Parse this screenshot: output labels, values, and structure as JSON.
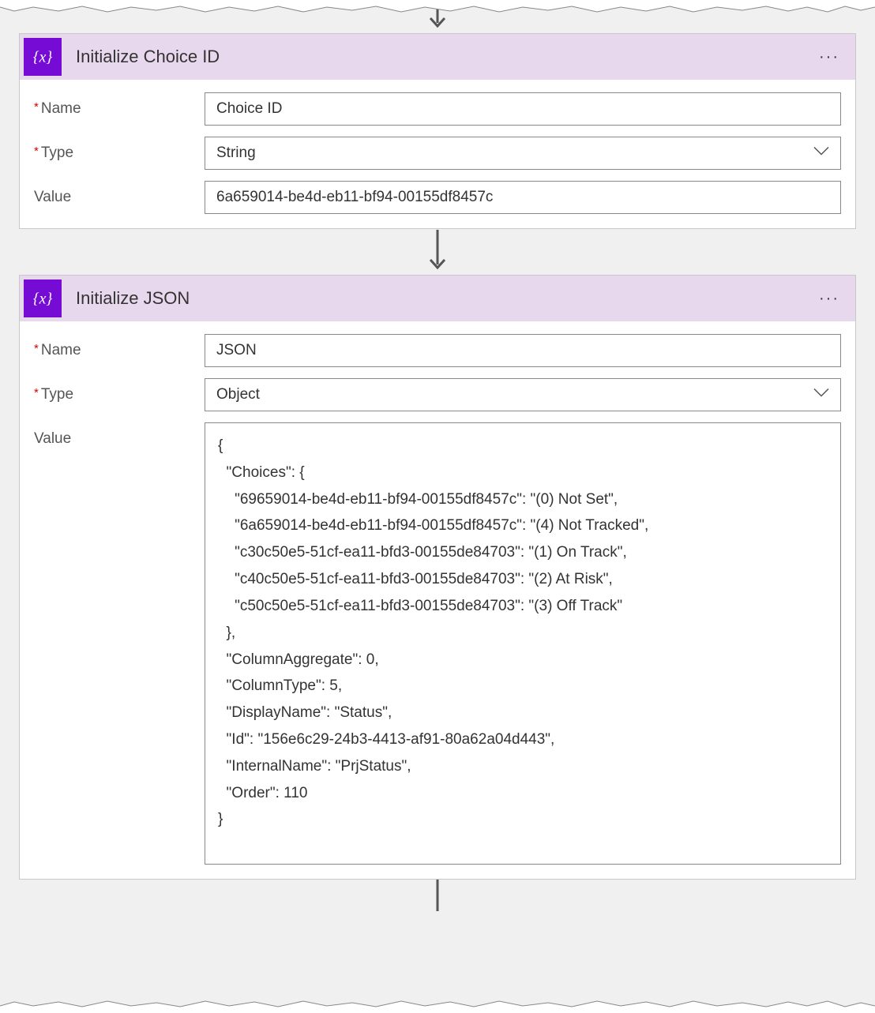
{
  "labels": {
    "name": "Name",
    "type": "Type",
    "value": "Value"
  },
  "actions": [
    {
      "title": "Initialize Choice ID",
      "name_value": "Choice ID",
      "type_value": "String",
      "value_kind": "text",
      "value_text": "6a659014-be4d-eb11-bf94-00155df8457c"
    },
    {
      "title": "Initialize JSON",
      "name_value": "JSON",
      "type_value": "Object",
      "value_kind": "textarea",
      "value_text": "{\n  \"Choices\": {\n    \"69659014-be4d-eb11-bf94-00155df8457c\": \"(0) Not Set\",\n    \"6a659014-be4d-eb11-bf94-00155df8457c\": \"(4) Not Tracked\",\n    \"c30c50e5-51cf-ea11-bfd3-00155de84703\": \"(1) On Track\",\n    \"c40c50e5-51cf-ea11-bfd3-00155de84703\": \"(2) At Risk\",\n    \"c50c50e5-51cf-ea11-bfd3-00155de84703\": \"(3) Off Track\"\n  },\n  \"ColumnAggregate\": 0,\n  \"ColumnType\": 5,\n  \"DisplayName\": \"Status\",\n  \"Id\": \"156e6c29-24b3-4413-af91-80a62a04d443\",\n  \"InternalName\": \"PrjStatus\",\n  \"Order\": 110\n}"
    }
  ]
}
